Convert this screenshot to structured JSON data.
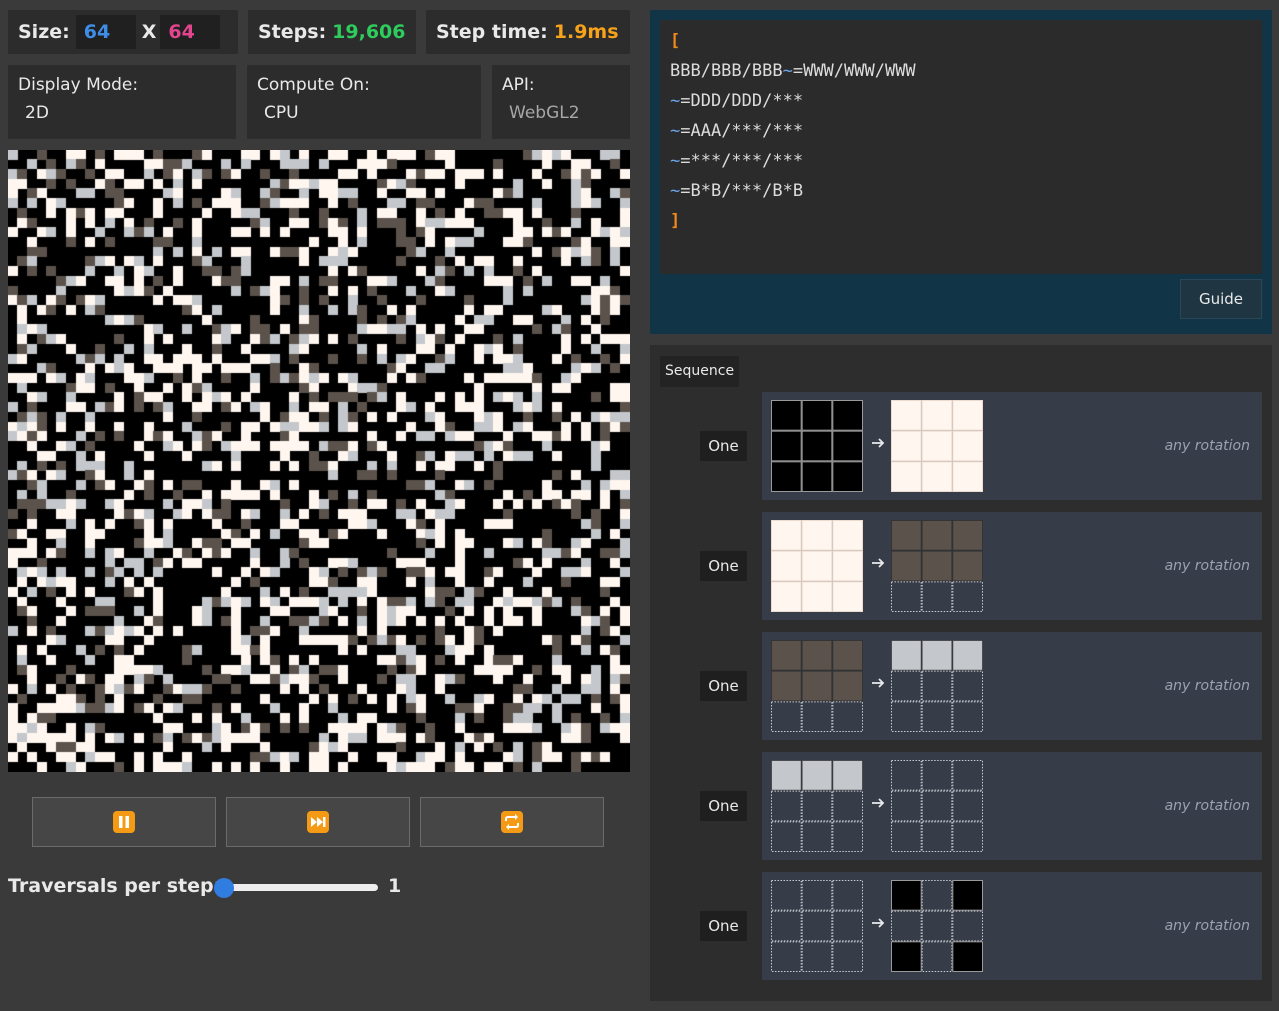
{
  "header": {
    "size_label": "Size:",
    "size_x": "64",
    "size_sep": "X",
    "size_y": "64",
    "steps_label": "Steps:",
    "steps_value": "19,606",
    "steptime_label": "Step time:",
    "steptime_value": "1.9ms"
  },
  "controls": {
    "display_mode": {
      "label": "Display Mode:",
      "value": "2D"
    },
    "compute_on": {
      "label": "Compute On:",
      "value": "CPU"
    },
    "api": {
      "label": "API:",
      "value": "WebGL2"
    }
  },
  "buttons": {
    "pause_icon": "pause-icon",
    "step_icon": "fast-forward-icon",
    "reset_icon": "repeat-icon"
  },
  "traversals": {
    "label": "Traversals per step:",
    "value": "1",
    "fraction": 0.0
  },
  "editor": {
    "open": "[",
    "lines": [
      {
        "head": "BBB/BBB/BBB",
        "tilde": "~",
        "rest": "=WWW/WWW/WWW"
      },
      {
        "head": "",
        "tilde": "~",
        "rest": "=DDD/DDD/***"
      },
      {
        "head": "",
        "tilde": "~",
        "rest": "=AAA/***/***"
      },
      {
        "head": "",
        "tilde": "~",
        "rest": "=***/***/***"
      },
      {
        "head": "",
        "tilde": "~",
        "rest": "=B*B/***/B*B"
      }
    ],
    "close": "]"
  },
  "guide_label": "Guide",
  "sequence_label": "Sequence",
  "colors": {
    "B": "#000000",
    "W": "#fff6ef",
    "D": "#5b524b",
    "A": "#c4c8cc",
    "steps": "#2ecc5c",
    "size_x": "#3e8ee8",
    "size_y": "#e2458e",
    "steptime": "#f7a21b",
    "bracket": "#f08a1c",
    "tilde": "#6aa6e8"
  },
  "rules": [
    {
      "mode": "One",
      "note": "any rotation",
      "in": "BBB/BBB/BBB",
      "out": "WWW/WWW/WWW"
    },
    {
      "mode": "One",
      "note": "any rotation",
      "in": "WWW/WWW/WWW",
      "out": "DDD/DDD/***"
    },
    {
      "mode": "One",
      "note": "any rotation",
      "in": "DDD/DDD/***",
      "out": "AAA/***/***"
    },
    {
      "mode": "One",
      "note": "any rotation",
      "in": "AAA/***/***",
      "out": "***/***/***"
    },
    {
      "mode": "One",
      "note": "any rotation",
      "in": "***/***/***",
      "out": "B*B/***/B*B"
    }
  ]
}
